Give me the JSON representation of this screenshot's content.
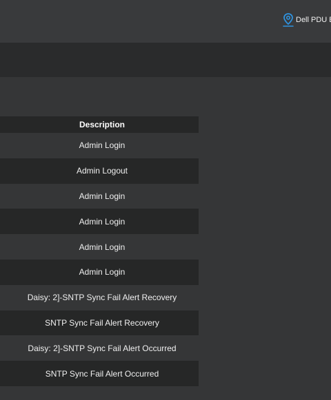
{
  "header": {
    "location_icon": "map-pin-icon",
    "location_label": "Dell PDU B",
    "accent_color": "#2f93e0"
  },
  "events_table": {
    "columns": [
      "Description"
    ],
    "rows": [
      {
        "description": "Admin Login"
      },
      {
        "description": "Admin Logout"
      },
      {
        "description": "Admin Login"
      },
      {
        "description": "Admin Login"
      },
      {
        "description": "Admin Login"
      },
      {
        "description": "Admin Login"
      },
      {
        "description": "Daisy: 2]-SNTP Sync Fail Alert Recovery"
      },
      {
        "description": "SNTP Sync Fail Alert Recovery"
      },
      {
        "description": "Daisy: 2]-SNTP Sync Fail Alert Occurred"
      },
      {
        "description": "SNTP Sync Fail Alert Occurred"
      }
    ]
  }
}
